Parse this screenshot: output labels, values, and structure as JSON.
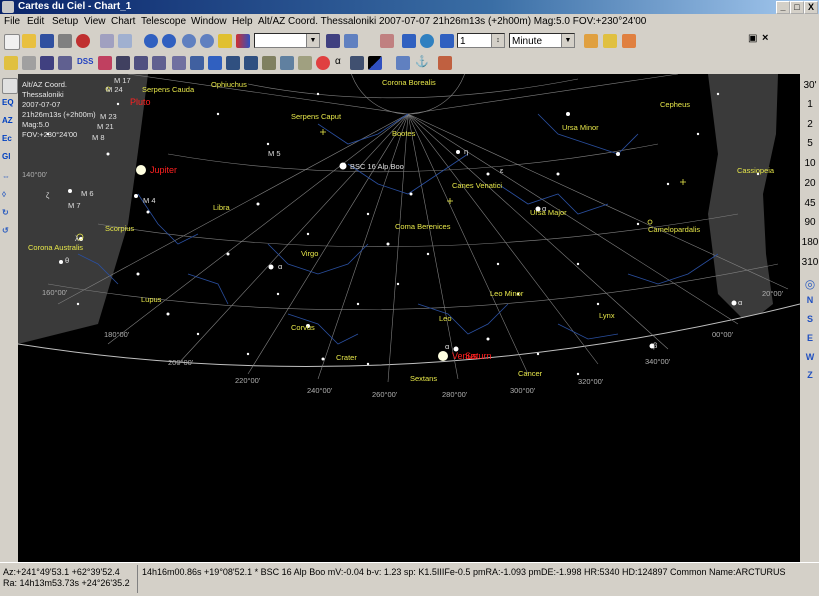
{
  "window": {
    "title": "Cartes du Ciel - Chart_1",
    "controls": [
      "_",
      "□",
      "X"
    ]
  },
  "menu": {
    "items": [
      "File",
      "Edit",
      "Setup",
      "View",
      "Chart",
      "Telescope",
      "Window",
      "Help"
    ],
    "chart_title": "Alt/AZ Coord. Thessaloniki 2007-07-07 21h26m13s (+2h00m) Mag:5.0 FOV:+230°24'00"
  },
  "toolbar": {
    "step_value": "1",
    "step_unit": "Minute",
    "mdi_controls": [
      "▣",
      "×"
    ]
  },
  "left_toolbar": [
    "EQ",
    "AZ",
    "Ec",
    "Gl"
  ],
  "right_toolbar": {
    "fov_levels": [
      "30'",
      "1",
      "2",
      "5",
      "10",
      "20",
      "45",
      "90",
      "180",
      "310"
    ],
    "directions": [
      "N",
      "S",
      "E",
      "W",
      "Z"
    ]
  },
  "chart_info": {
    "lines": [
      "Alt/AZ Coord.",
      "Thessaloniki",
      "2007-07-07",
      "21h26m13s (+2h00m)",
      "Mag:5.0",
      "FOV:+230°24'00"
    ]
  },
  "constellations": [
    "Serpens Cauda",
    "Ophiuchus",
    "Corona Borealis",
    "Cepheus",
    "Serpens Caput",
    "Bootes",
    "Ursa Minor",
    "Cassiopeia",
    "Canes Venatici",
    "Libra",
    "Ursa Major",
    "Scorpius",
    "Coma Berenices",
    "Camelopardalis",
    "Corona Australis",
    "Virgo",
    "Leo Minor",
    "Lupus",
    "Leo",
    "Lynx",
    "Corvus",
    "Crater",
    "Sextans",
    "Cancer"
  ],
  "planets": [
    "Pluto",
    "Jupiter",
    "Venus",
    "Saturn"
  ],
  "objects": [
    "M 17",
    "M 24",
    "M 23",
    "M 21",
    "M 8",
    "M 5",
    "M 6",
    "M 7",
    "M 4",
    "BSC 16 Alp Boo"
  ],
  "greek": [
    "η",
    "ε",
    "α",
    "ζ",
    "λ",
    "θ",
    "α",
    "β",
    "α",
    "α"
  ],
  "azimuths": [
    "140°00'",
    "160°00'",
    "180°00'",
    "200°00'",
    "220°00'",
    "240°00'",
    "260°00'",
    "280°00'",
    "300°00'",
    "320°00'",
    "340°00'",
    "00°00'",
    "20°00'"
  ],
  "status": {
    "az": "Az:+241°49'53.1 +62°39'52.4",
    "ra": "Ra: 14h13m53.73s +24°26'35.2",
    "object": "14h16m00.86s +19°08'52.1 * BSC 16 Alp Boo mV:-0.04 b-v: 1.23 sp: K1.5IIIFe-0.5 pmRA:-1.093 pmDE:-1.998 HR:5340 HD:124897 Common Name:ARCTURUS"
  },
  "colors": {
    "titlebar": "#0a246a",
    "sky": "#000000",
    "horizon": "#3c3c3c",
    "constellation_label": "#e8e84a",
    "constellation_line": "#2a4fa0",
    "planet_label": "#ff2020"
  }
}
